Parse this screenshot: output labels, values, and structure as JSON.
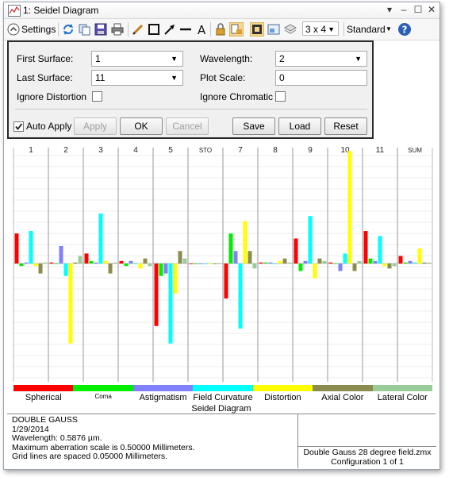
{
  "window": {
    "title": "1: Seidel Diagram",
    "controls": [
      "▾",
      "–",
      "☐",
      "✕"
    ]
  },
  "toolbar": {
    "settings_label": "Settings",
    "layout_value": "3 x 4",
    "standard_label": "Standard"
  },
  "settings": {
    "first_surface_label": "First Surface:",
    "first_surface_value": "1",
    "last_surface_label": "Last Surface:",
    "last_surface_value": "11",
    "ignore_distortion_label": "Ignore Distortion",
    "wavelength_label": "Wavelength:",
    "wavelength_value": "2",
    "plot_scale_label": "Plot Scale:",
    "plot_scale_value": "0",
    "ignore_chromatic_label": "Ignore Chromatic",
    "auto_apply_label": "Auto Apply",
    "apply_label": "Apply",
    "ok_label": "OK",
    "cancel_label": "Cancel",
    "save_label": "Save",
    "load_label": "Load",
    "reset_label": "Reset"
  },
  "colors": {
    "spherical": "#ff0000",
    "coma": "#00ee00",
    "astigmatism": "#8080ff",
    "field_curvature": "#00ffff",
    "distortion": "#ffff00",
    "axial_color": "#8c8c50",
    "lateral_color": "#99cc99"
  },
  "chart_data": {
    "type": "bar",
    "title": "Seidel Diagram",
    "categories": [
      "1",
      "2",
      "3",
      "4",
      "5",
      "STO",
      "7",
      "8",
      "9",
      "10",
      "11",
      "SUM"
    ],
    "series": [
      {
        "name": "Spherical",
        "values": [
          0.6,
          0.02,
          0.2,
          0.05,
          -1.25,
          0.0,
          -0.7,
          0.02,
          0.5,
          0.02,
          0.65,
          0.15
        ]
      },
      {
        "name": "Coma",
        "values": [
          -0.05,
          0.0,
          0.05,
          -0.05,
          -0.25,
          0.0,
          0.6,
          0.02,
          -0.15,
          0.0,
          0.1,
          0.02
        ]
      },
      {
        "name": "Astigmatism",
        "values": [
          0.02,
          0.35,
          0.02,
          0.05,
          -0.2,
          0.0,
          0.25,
          0.02,
          0.05,
          -0.15,
          0.05,
          0.05
        ]
      },
      {
        "name": "Field Curvature",
        "values": [
          0.65,
          -0.25,
          1.0,
          0.0,
          -1.6,
          0.0,
          -1.3,
          0.0,
          0.95,
          0.2,
          0.55,
          0.02
        ]
      },
      {
        "name": "Distortion",
        "values": [
          -0.05,
          -1.6,
          0.05,
          -0.1,
          -0.6,
          0.0,
          0.85,
          0.05,
          -0.3,
          2.25,
          -0.05,
          0.3
        ]
      },
      {
        "name": "Axial Color",
        "values": [
          -0.2,
          0.02,
          -0.2,
          0.1,
          0.25,
          0.0,
          0.25,
          0.1,
          0.1,
          -0.15,
          -0.1,
          0.02
        ]
      },
      {
        "name": "Lateral Color",
        "values": [
          0.02,
          0.15,
          0.02,
          -0.05,
          0.1,
          0.0,
          -0.1,
          0.02,
          0.05,
          0.05,
          -0.05,
          0.02
        ]
      }
    ],
    "legend_labels": [
      "Spherical",
      "Coma",
      "Astigmatism",
      "Field Curvature",
      "Distortion",
      "Axial Color",
      "Lateral Color"
    ],
    "grid": true
  },
  "info": {
    "line1": "DOUBLE GAUSS",
    "line2": "1/29/2014",
    "line3": "Wavelength: 0.5876 µm.",
    "line4": "Maximum aberration scale is 0.50000 Millimeters.",
    "line5": "Grid lines are spaced 0.05000 Millimeters.",
    "file": "Double Gauss 28 degree field.zmx",
    "config": "Configuration 1 of 1"
  }
}
